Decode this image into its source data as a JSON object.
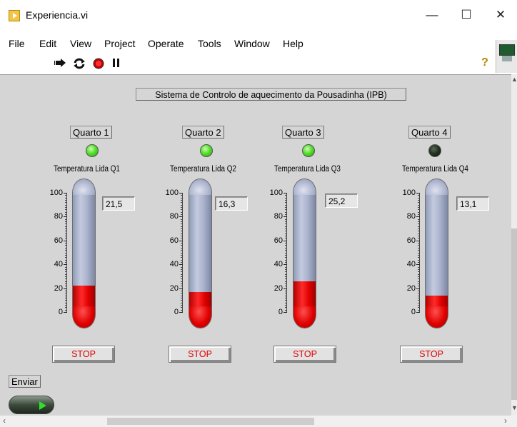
{
  "window": {
    "title": "Experiencia.vi",
    "minimize": "—",
    "maximize": "☐",
    "close": "✕"
  },
  "menu": [
    "File",
    "Edit",
    "View",
    "Project",
    "Operate",
    "Tools",
    "Window",
    "Help"
  ],
  "toolbar": {
    "run_icon": "run-arrow-icon",
    "run_continuous_icon": "run-continuously-icon",
    "abort_icon": "abort-icon",
    "pause_icon": "pause-icon",
    "help_icon": "context-help-icon"
  },
  "panel": {
    "header": "Sistema de Controlo de aquecimento da Pousadinha (IPB)",
    "scale_ticks": [
      "100",
      "80",
      "60",
      "40",
      "20",
      "0"
    ],
    "rooms": [
      {
        "name": "Quarto 1",
        "led_on": true,
        "therm_title": "Temperatura Lida Q1",
        "value": "21,5",
        "level": 21.5,
        "stop_label": "STOP"
      },
      {
        "name": "Quarto 2",
        "led_on": true,
        "therm_title": "Temperatura Lida Q2",
        "value": "16,3",
        "level": 16.3,
        "stop_label": "STOP"
      },
      {
        "name": "Quarto 3",
        "led_on": true,
        "therm_title": "Temperatura Lida Q3",
        "value": "25,2",
        "level": 25.2,
        "stop_label": "STOP"
      },
      {
        "name": "Quarto 4",
        "led_on": false,
        "therm_title": "Temperatura Lida Q4",
        "value": "13,1",
        "level": 13.1,
        "stop_label": "STOP"
      }
    ],
    "enviar_label": "Enviar"
  },
  "colors": {
    "led_on": "#56e02e",
    "led_off": "#203020",
    "mercury": "#ff0000",
    "panel_bg": "#d5d5d5",
    "stop_text": "#e00000"
  }
}
